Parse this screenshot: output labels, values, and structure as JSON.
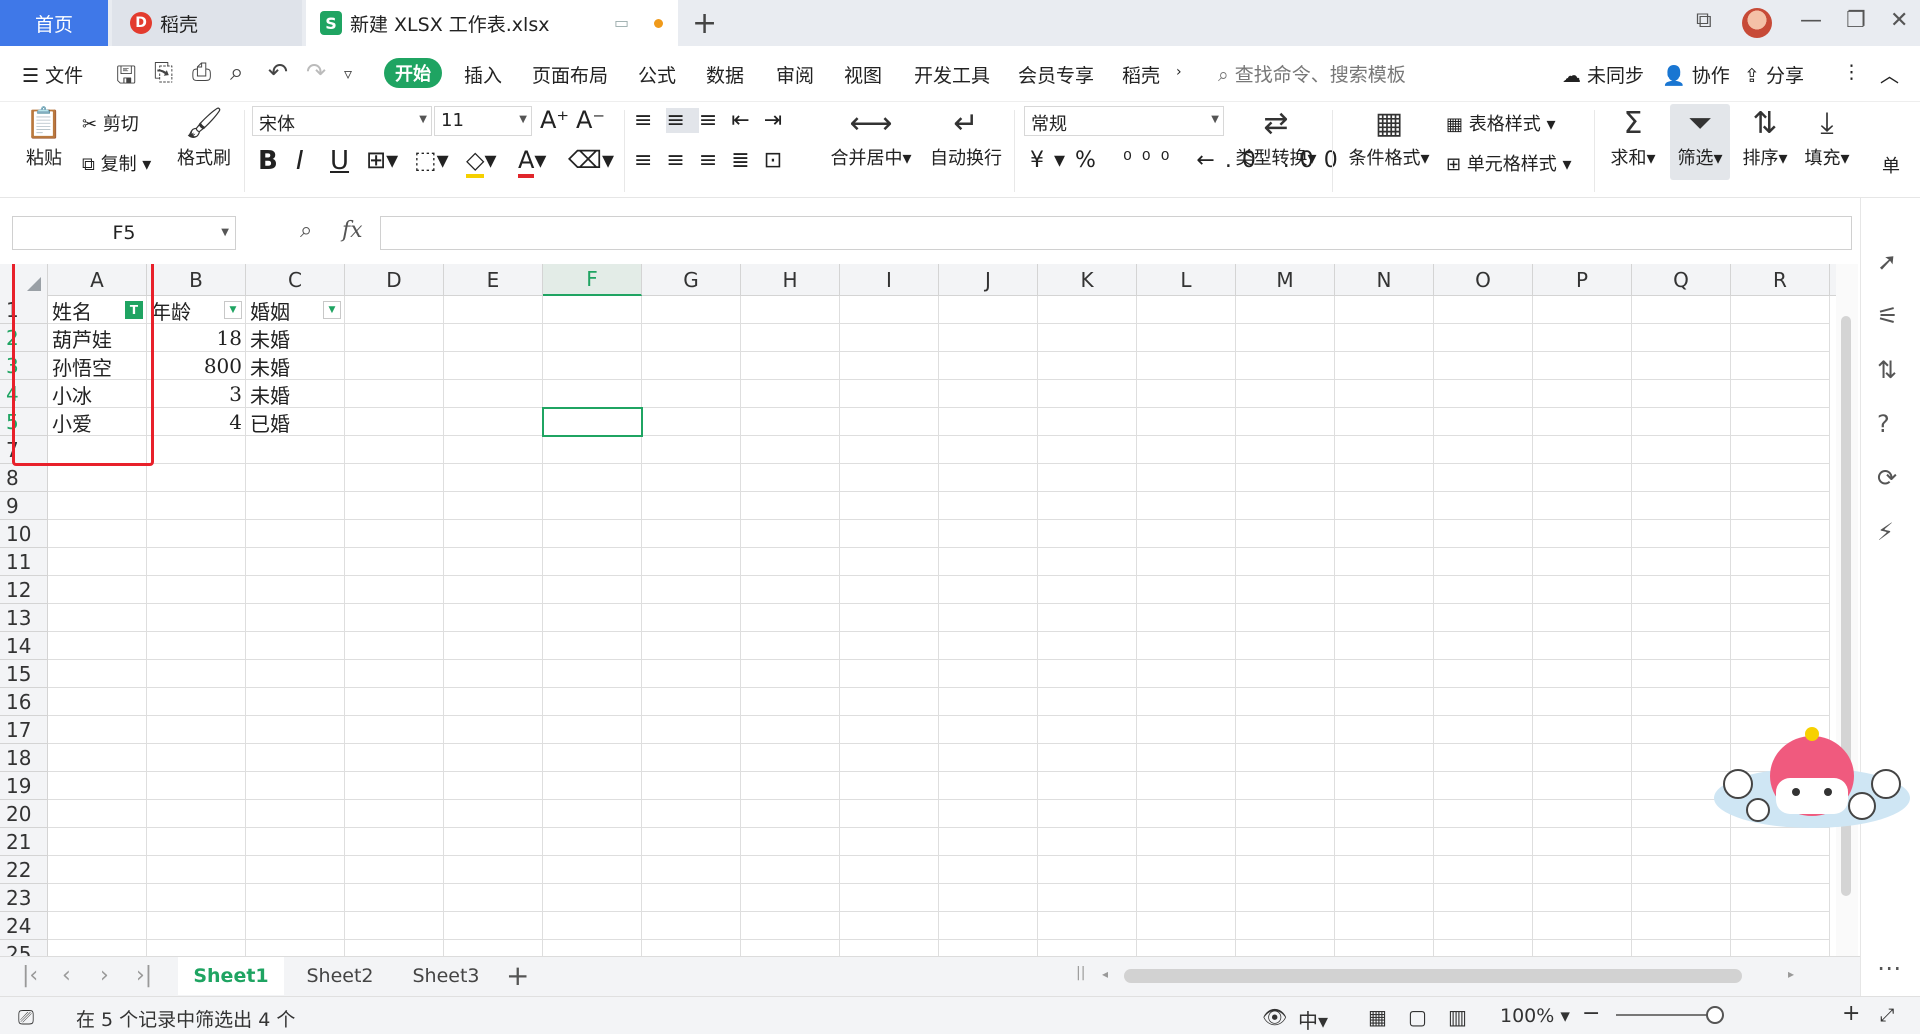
{
  "tabs": {
    "home": "首页",
    "daoke": "稻壳",
    "document": "新建 XLSX 工作表.xlsx"
  },
  "menu": {
    "file": "文件",
    "items": [
      "开始",
      "插入",
      "页面布局",
      "公式",
      "数据",
      "审阅",
      "视图",
      "开发工具",
      "会员专享",
      "稻壳"
    ],
    "search_placeholder": "查找命令、搜索模板",
    "sync": "未同步",
    "collab": "协作",
    "share": "分享"
  },
  "ribbon": {
    "paste": "粘贴",
    "cut": "剪切",
    "copy": "复制",
    "format_painter": "格式刷",
    "font_name": "宋体",
    "font_size": "11",
    "merge_center": "合并居中",
    "wrap_text": "自动换行",
    "number_format": "常规",
    "type_convert": "类型转换",
    "conditional_format": "条件格式",
    "table_style": "表格样式",
    "cell_style": "单元格样式",
    "sum": "求和",
    "filter": "筛选",
    "sort": "排序",
    "fill": "填充",
    "single": "单"
  },
  "formula_bar": {
    "name_box": "F5",
    "fx_label": "fx",
    "formula": ""
  },
  "grid": {
    "columns": [
      "A",
      "B",
      "C",
      "D",
      "E",
      "F",
      "G",
      "H",
      "I",
      "J",
      "K",
      "L",
      "M",
      "N",
      "O",
      "P",
      "Q",
      "R"
    ],
    "selected_column": "F",
    "rows": [
      "1",
      "2",
      "3",
      "4",
      "5",
      "7",
      "8",
      "9",
      "10",
      "11",
      "12",
      "13",
      "14",
      "15",
      "16",
      "17",
      "18",
      "19",
      "20",
      "21",
      "22",
      "23",
      "24",
      "25"
    ],
    "header": [
      "姓名",
      "年龄",
      "婚姻"
    ],
    "data": [
      [
        "葫芦娃",
        "18",
        "未婚"
      ],
      [
        "孙悟空",
        "800",
        "未婚"
      ],
      [
        "小冰",
        "3",
        "未婚"
      ],
      [
        "小爱",
        "4",
        "已婚"
      ]
    ]
  },
  "sheets": [
    "Sheet1",
    "Sheet2",
    "Sheet3"
  ],
  "status": {
    "message": "在 5 个记录中筛选出 4 个",
    "zoom": "100%"
  }
}
